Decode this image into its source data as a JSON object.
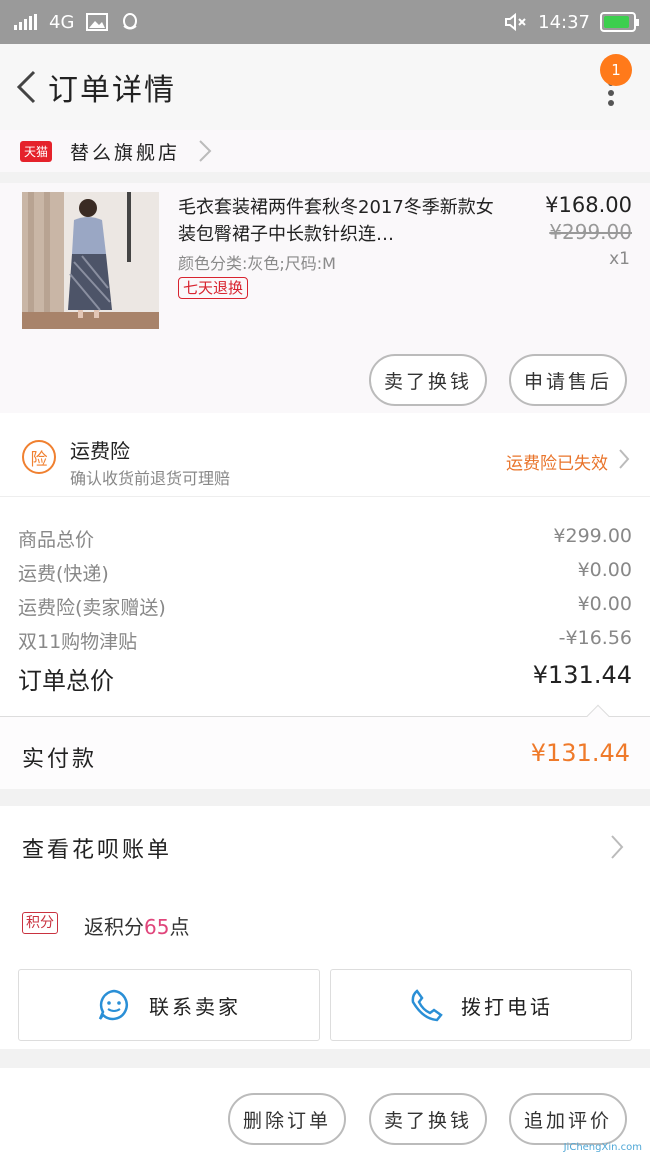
{
  "status_bar": {
    "network": "4G",
    "time": "14:37",
    "battery_level": 0.9
  },
  "header": {
    "title": "订单详情",
    "badge_count": "1"
  },
  "store": {
    "platform_badge": "天猫",
    "name": "替么旗舰店"
  },
  "product": {
    "name": "毛衣套装裙两件套秋冬2017冬季新款女装包臀裙子中长款针织连…",
    "spec": "颜色分类:灰色;尺码:M",
    "tag": "七天退换",
    "price": "¥168.00",
    "original_price": "¥299.00",
    "quantity": "x1",
    "actions": [
      "卖了换钱",
      "申请售后"
    ]
  },
  "insurance": {
    "icon_text": "险",
    "title": "运费险",
    "subtitle": "确认收货前退货可理赔",
    "status": "运费险已失效"
  },
  "summary": {
    "rows": [
      {
        "label": "商品总价",
        "value": "¥299.00"
      },
      {
        "label": "运费(快递)",
        "value": "¥0.00"
      },
      {
        "label": "运费险(卖家赠送)",
        "value": "¥0.00"
      },
      {
        "label": "双11购物津贴",
        "value": "-¥16.56"
      }
    ],
    "total_label": "订单总价",
    "total_value": "¥131.44"
  },
  "paid": {
    "label": "实付款",
    "value": "¥131.44"
  },
  "huabei": {
    "label": "查看花呗账单"
  },
  "points": {
    "badge": "积分",
    "prefix": "返积分",
    "amount": "65",
    "suffix": "点"
  },
  "contact": {
    "seller_label": "联系卖家",
    "phone_label": "拨打电话"
  },
  "bottom_actions": [
    "删除订单",
    "卖了换钱",
    "追加评价"
  ],
  "watermark": "JiChengXin.com",
  "colors": {
    "accent": "#ef7a2a",
    "tmall_red": "#e5222b",
    "points_pink": "#e0457b",
    "phone_blue": "#2a8fd6"
  }
}
